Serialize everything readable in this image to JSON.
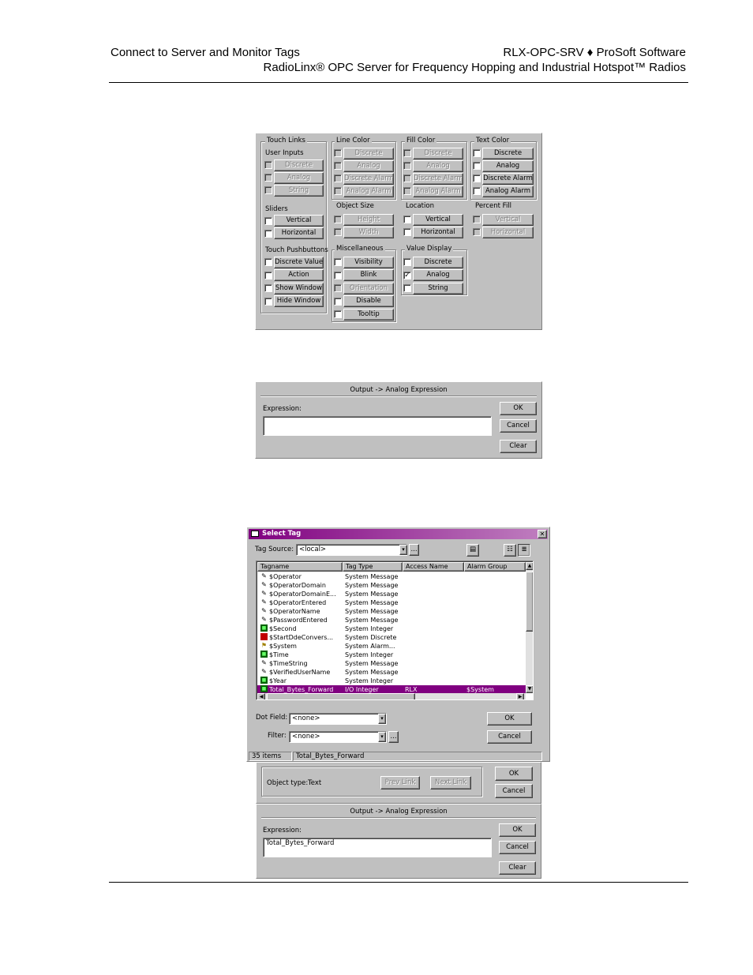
{
  "header": {
    "left": "Connect to Server and Monitor Tags",
    "right_line1": "RLX-OPC-SRV ♦ ProSoft Software",
    "right_line2": "RadioLinx® OPC Server for Frequency Hopping and Industrial Hotspot™ Radios"
  },
  "animation": {
    "groups": {
      "touch_links": "Touch Links",
      "user_inputs": "User Inputs",
      "sliders": "Sliders",
      "touch_pushbuttons": "Touch Pushbuttons",
      "line_color": "Line Color",
      "object_size": "Object Size",
      "miscellaneous": "Miscellaneous",
      "fill_color": "Fill Color",
      "location": "Location",
      "value_display": "Value Display",
      "text_color": "Text Color",
      "percent_fill": "Percent Fill"
    },
    "buttons": {
      "ui_discrete": "Discrete",
      "ui_analog": "Analog",
      "ui_string": "String",
      "sl_vertical": "Vertical",
      "sl_horizontal": "Horizontal",
      "tp_discrete_value": "Discrete Value",
      "tp_action": "Action",
      "tp_show_window": "Show Window",
      "tp_hide_window": "Hide Window",
      "lc_discrete": "Discrete",
      "lc_analog": "Analog",
      "lc_discrete_alarm": "Discrete Alarm",
      "lc_analog_alarm": "Analog Alarm",
      "os_height": "Height",
      "os_width": "Width",
      "mi_visibility": "Visibility",
      "mi_blink": "Blink",
      "mi_orientation": "Orientation",
      "mi_disable": "Disable",
      "mi_tooltip": "Tooltip",
      "fc_discrete": "Discrete",
      "fc_analog": "Analog",
      "fc_discrete_alarm": "Discrete Alarm",
      "fc_analog_alarm": "Analog Alarm",
      "lo_vertical": "Vertical",
      "lo_horizontal": "Horizontal",
      "vd_discrete": "Discrete",
      "vd_analog": "Analog",
      "vd_string": "String",
      "tc_discrete": "Discrete",
      "tc_analog": "Analog",
      "tc_discrete_alarm": "Discrete Alarm",
      "tc_analog_alarm": "Analog Alarm",
      "pf_vertical": "Vertical",
      "pf_horizontal": "Horizontal"
    },
    "checked_mark": "✓"
  },
  "expr1": {
    "title": "Output -> Analog Expression",
    "label": "Expression:",
    "value": "",
    "ok": "OK",
    "cancel": "Cancel",
    "clear": "Clear"
  },
  "select_tag": {
    "title": "Select Tag",
    "close": "✕",
    "tag_source_label": "Tag Source:",
    "tag_source_value": "<local>",
    "browse": "...",
    "columns": [
      "Tagname",
      "Tag Type",
      "Access Name",
      "Alarm Group"
    ],
    "rows": [
      {
        "icon": "msg",
        "name": "$Operator",
        "type": "System Message",
        "access": "",
        "group": ""
      },
      {
        "icon": "msg",
        "name": "$OperatorDomain",
        "type": "System Message",
        "access": "",
        "group": ""
      },
      {
        "icon": "msg",
        "name": "$OperatorDomainE...",
        "type": "System Message",
        "access": "",
        "group": ""
      },
      {
        "icon": "msg",
        "name": "$OperatorEntered",
        "type": "System Message",
        "access": "",
        "group": ""
      },
      {
        "icon": "msg",
        "name": "$OperatorName",
        "type": "System Message",
        "access": "",
        "group": ""
      },
      {
        "icon": "msg",
        "name": "$PasswordEntered",
        "type": "System Message",
        "access": "",
        "group": ""
      },
      {
        "icon": "int",
        "name": "$Second",
        "type": "System Integer",
        "access": "",
        "group": ""
      },
      {
        "icon": "dsc",
        "name": "$StartDdeConvers...",
        "type": "System Discrete",
        "access": "",
        "group": ""
      },
      {
        "icon": "alm",
        "name": "$System",
        "type": "System Alarm...",
        "access": "",
        "group": ""
      },
      {
        "icon": "int",
        "name": "$Time",
        "type": "System Integer",
        "access": "",
        "group": ""
      },
      {
        "icon": "msg",
        "name": "$TimeString",
        "type": "System Message",
        "access": "",
        "group": ""
      },
      {
        "icon": "msg",
        "name": "$VerifiedUserName",
        "type": "System Message",
        "access": "",
        "group": ""
      },
      {
        "icon": "int",
        "name": "$Year",
        "type": "System Integer",
        "access": "",
        "group": ""
      },
      {
        "icon": "int",
        "name": "Total_Bytes_Forward",
        "type": "I/O Integer",
        "access": "RLX",
        "group": "$System",
        "selected": true
      }
    ],
    "dot_field_label": "Dot Field:",
    "dot_field_value": "<none>",
    "filter_label": "Filter:",
    "filter_value": "<none>",
    "ok": "OK",
    "cancel": "Cancel",
    "status_count": "35 items",
    "status_selected": "Total_Bytes_Forward"
  },
  "link_bar": {
    "object_type_label": "Object type:",
    "object_type_value": "Text",
    "prev_link": "Prev Link",
    "next_link": "Next Link",
    "ok": "OK",
    "cancel": "Cancel"
  },
  "expr2": {
    "title": "Output -> Analog Expression",
    "label": "Expression:",
    "value": "Total_Bytes_Forward",
    "ok": "OK",
    "cancel": "Cancel",
    "clear": "Clear"
  }
}
